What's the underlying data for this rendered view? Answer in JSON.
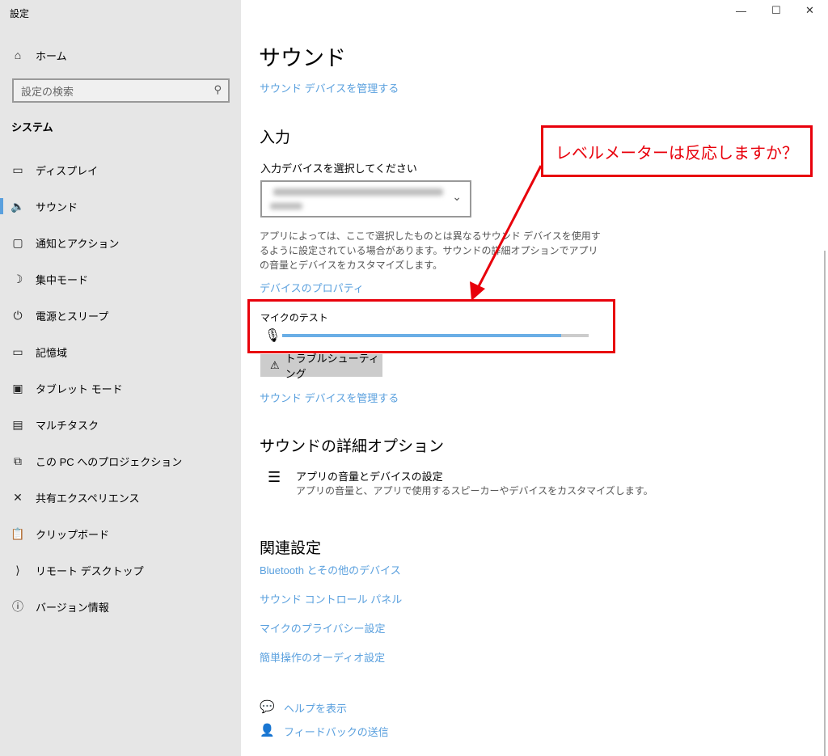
{
  "window": {
    "title": "設定",
    "minimize": "—",
    "maximize": "☐",
    "close": "✕"
  },
  "sidebar": {
    "home": "ホーム",
    "search_placeholder": "設定の検索",
    "section": "システム",
    "items": [
      {
        "label": "ディスプレイ",
        "icon": "monitor-icon"
      },
      {
        "label": "サウンド",
        "icon": "speaker-icon",
        "selected": true
      },
      {
        "label": "通知とアクション",
        "icon": "notification-icon"
      },
      {
        "label": "集中モード",
        "icon": "moon-icon"
      },
      {
        "label": "電源とスリープ",
        "icon": "power-icon"
      },
      {
        "label": "記憶域",
        "icon": "storage-icon"
      },
      {
        "label": "タブレット モード",
        "icon": "tablet-icon"
      },
      {
        "label": "マルチタスク",
        "icon": "multitask-icon"
      },
      {
        "label": "この PC へのプロジェクション",
        "icon": "projection-icon"
      },
      {
        "label": "共有エクスペリエンス",
        "icon": "share-icon"
      },
      {
        "label": "クリップボード",
        "icon": "clipboard-icon"
      },
      {
        "label": "リモート デスクトップ",
        "icon": "remote-icon"
      },
      {
        "label": "バージョン情報",
        "icon": "info-icon"
      }
    ]
  },
  "main": {
    "title": "サウンド",
    "manage_link_top": "サウンド デバイスを管理する",
    "input_heading": "入力",
    "select_label": "入力デバイスを選択してください",
    "description": "アプリによっては、ここで選択したものとは異なるサウンド デバイスを使用するように設定されている場合があります。サウンドの詳細オプションでアプリの音量とデバイスをカスタマイズします。",
    "device_properties": "デバイスのプロパティ",
    "mic_test_label": "マイクのテスト",
    "mic_level_percent": 91,
    "troubleshoot": "トラブルシューティング",
    "manage_link": "サウンド デバイスを管理する",
    "advanced_heading": "サウンドの詳細オプション",
    "app_volume_title": "アプリの音量とデバイスの設定",
    "app_volume_desc": "アプリの音量と、アプリで使用するスピーカーやデバイスをカスタマイズします。",
    "related_heading": "関連設定",
    "related_links": [
      "Bluetooth とその他のデバイス",
      "サウンド コントロール パネル",
      "マイクのプライバシー設定",
      "簡単操作のオーディオ設定"
    ],
    "help": "ヘルプを表示",
    "feedback": "フィードバックの送信"
  },
  "annotation": {
    "callout": "レベルメーターは反応しますか？",
    "color": "#e8000b"
  },
  "colors": {
    "accent": "#5aa0de",
    "sidebar_bg": "#e6e6e6"
  }
}
